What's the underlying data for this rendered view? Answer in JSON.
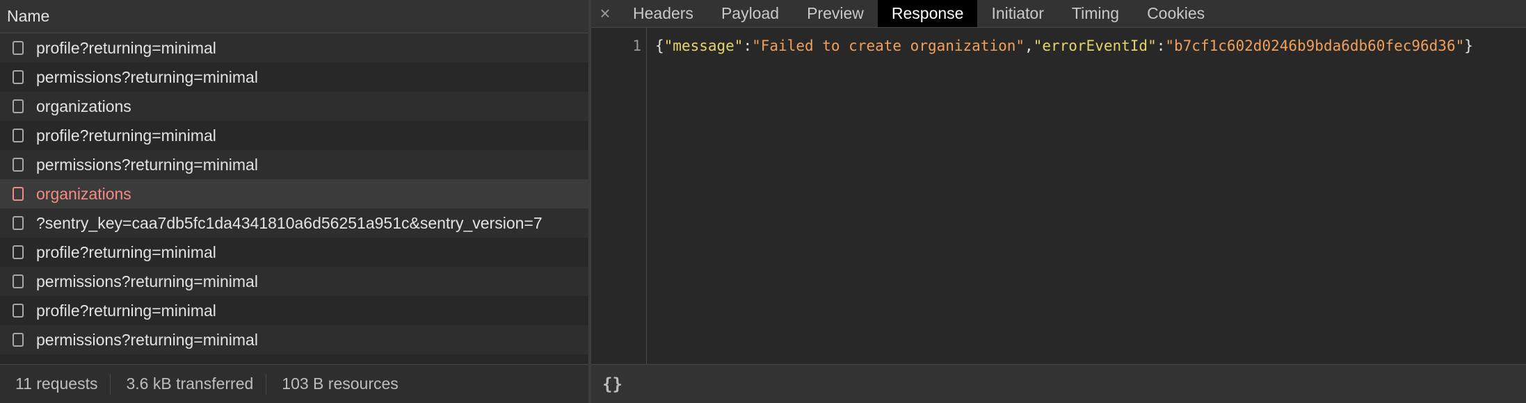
{
  "list": {
    "header": "Name",
    "rows": [
      "profile?returning=minimal",
      "permissions?returning=minimal",
      "organizations",
      "profile?returning=minimal",
      "permissions?returning=minimal",
      "organizations",
      "?sentry_key=caa7db5fc1da4341810a6d56251a951c&sentry_version=7",
      "profile?returning=minimal",
      "permissions?returning=minimal",
      "profile?returning=minimal",
      "permissions?returning=minimal"
    ],
    "selected_row": "organizations",
    "footer": {
      "requests": "11 requests",
      "transferred": "3.6 kB transferred",
      "resources": "103 B resources"
    }
  },
  "details": {
    "close": "×",
    "tabs": [
      "Headers",
      "Payload",
      "Preview",
      "Response",
      "Initiator",
      "Timing",
      "Cookies"
    ],
    "active_tab": "Response",
    "response": {
      "line_number": "1",
      "open_brace": "{",
      "key1": "\"message\"",
      "colon1": ":",
      "value1": "\"Failed to create organization\"",
      "comma": ",",
      "key2": "\"errorEventId\"",
      "colon2": ":",
      "value2": "\"b7cf1c602d0246b9bda6db60fec96d36\"",
      "close_brace": "}"
    },
    "format_button": "{}"
  },
  "colors": {
    "error_text": "#f28b82",
    "json_key": "#e5d46a",
    "json_string": "#f0a05a",
    "active_tab_bg": "#000000"
  }
}
